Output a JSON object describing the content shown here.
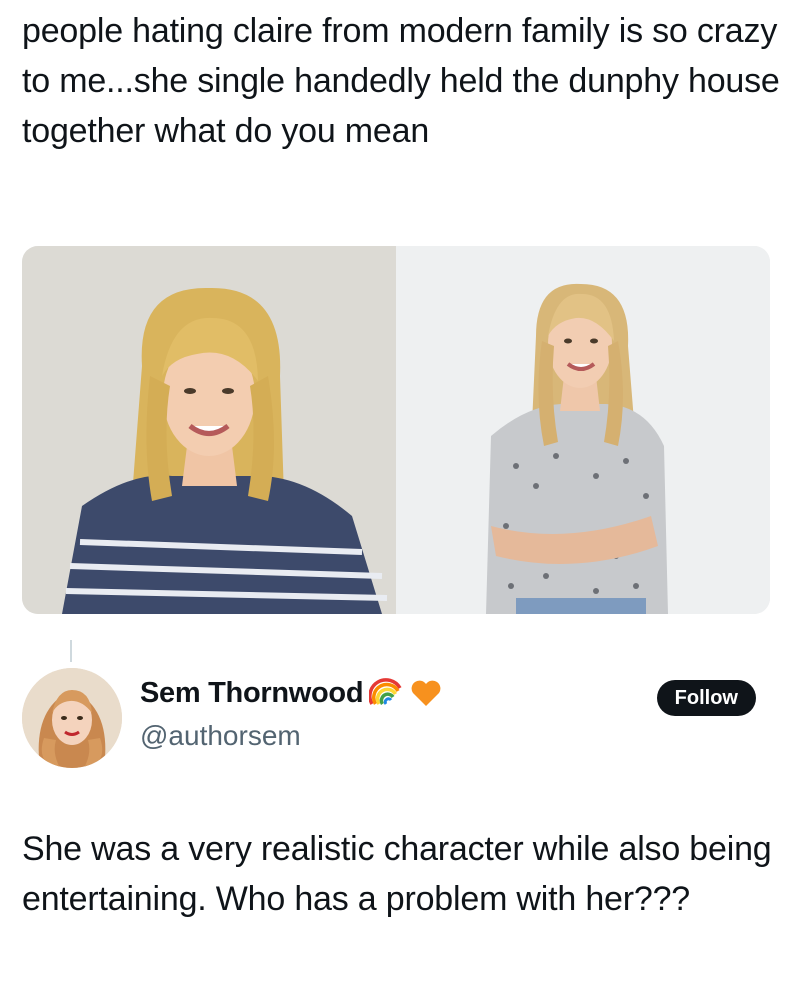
{
  "post": {
    "text": "people hating claire from modern family is so crazy to me...she single handedly held the dunphy house together what do you mean"
  },
  "media": {
    "panels": [
      {
        "name": "photo-left"
      },
      {
        "name": "photo-right"
      }
    ]
  },
  "reply": {
    "display_name": "Sem Thornwood",
    "handle": "@authorsem",
    "badges": [
      "rainbow-icon",
      "orange-heart-icon"
    ],
    "follow_label": "Follow",
    "text": "She was a very realistic character while also being entertaining. Who has a problem with her???"
  },
  "colors": {
    "text": "#0f1419",
    "secondary": "#536471",
    "follow_bg": "#0f1419",
    "follow_text": "#ffffff",
    "divider": "#cfd9de"
  }
}
